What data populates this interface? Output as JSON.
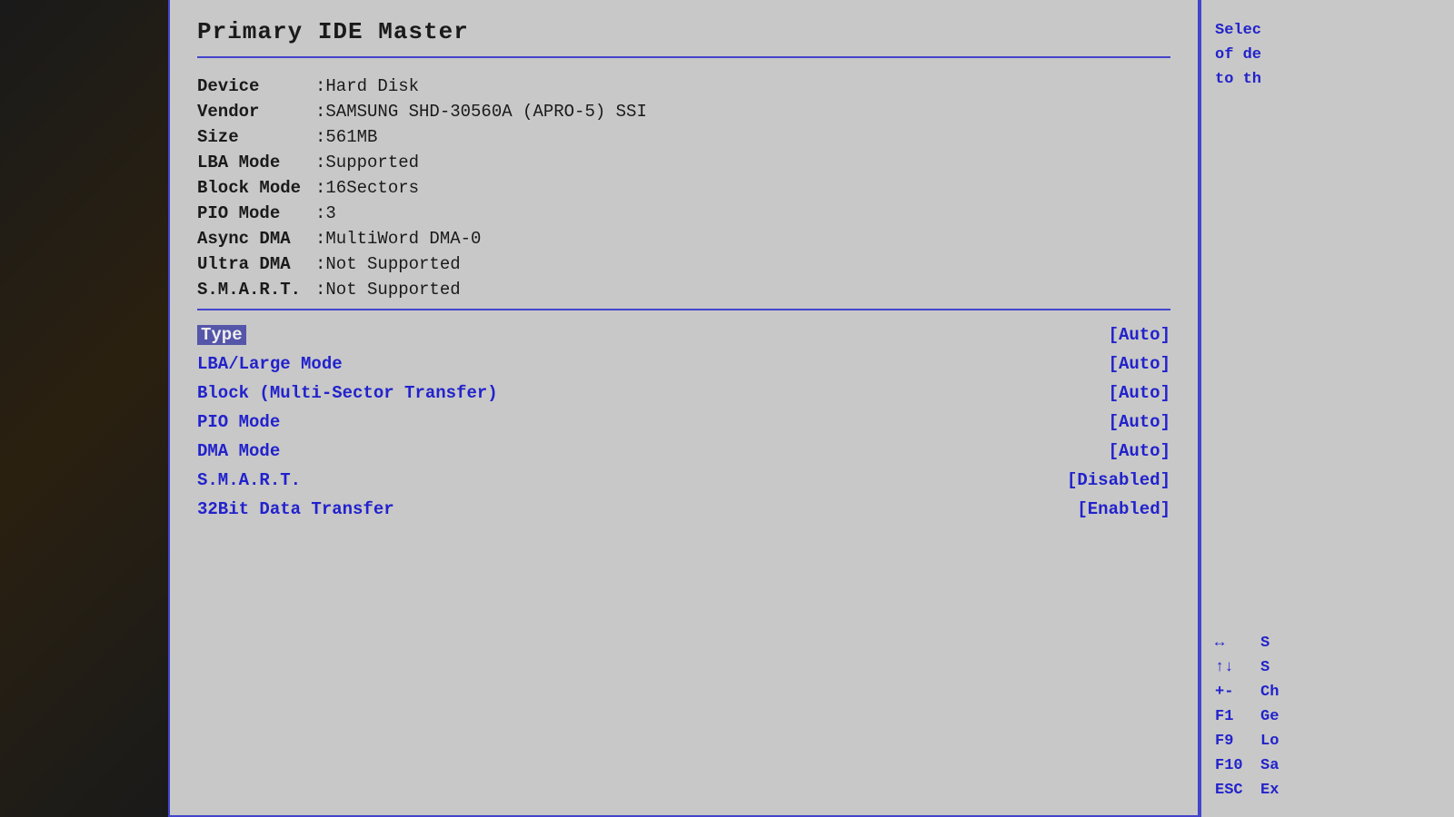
{
  "page": {
    "title": "Primary IDE Master"
  },
  "device_info": {
    "rows": [
      {
        "label": "Device",
        "value": ":Hard Disk"
      },
      {
        "label": "Vendor",
        "value": ":SAMSUNG SHD-30560A (APRO-5)  SSI"
      },
      {
        "label": "Size",
        "value": ":561MB"
      },
      {
        "label": "LBA Mode",
        "value": ":Supported"
      },
      {
        "label": "Block Mode",
        "value": ":16Sectors"
      },
      {
        "label": "PIO Mode",
        "value": ":3"
      },
      {
        "label": "Async DMA",
        "value": ":MultiWord DMA-0"
      },
      {
        "label": "Ultra DMA",
        "value": ":Not Supported"
      },
      {
        "label": "S.M.A.R.T.",
        "value": ":Not Supported"
      }
    ]
  },
  "settings": {
    "rows": [
      {
        "label": "Type",
        "value": "[Auto]",
        "highlighted": true
      },
      {
        "label": "LBA/Large Mode",
        "value": "[Auto]",
        "highlighted": false
      },
      {
        "label": "Block (Multi-Sector Transfer)",
        "value": "[Auto]",
        "highlighted": false
      },
      {
        "label": "PIO Mode",
        "value": "[Auto]",
        "highlighted": false
      },
      {
        "label": "DMA Mode",
        "value": "[Auto]",
        "highlighted": false
      },
      {
        "label": "S.M.A.R.T.",
        "value": "[Disabled]",
        "highlighted": false
      },
      {
        "label": "32Bit Data Transfer",
        "value": "[Enabled]",
        "highlighted": false
      }
    ]
  },
  "right_panel": {
    "help_text": "Selec\nof de\nto th",
    "keys": [
      {
        "sym": "↔",
        "desc": "S"
      },
      {
        "sym": "↑↓",
        "desc": "S"
      },
      {
        "sym": "+-",
        "desc": "Ch"
      },
      {
        "sym": "F1",
        "desc": "Ge"
      },
      {
        "sym": "F9",
        "desc": "Lo"
      },
      {
        "sym": "F10",
        "desc": "Sa"
      },
      {
        "sym": "ESC",
        "desc": "Ex"
      }
    ]
  }
}
